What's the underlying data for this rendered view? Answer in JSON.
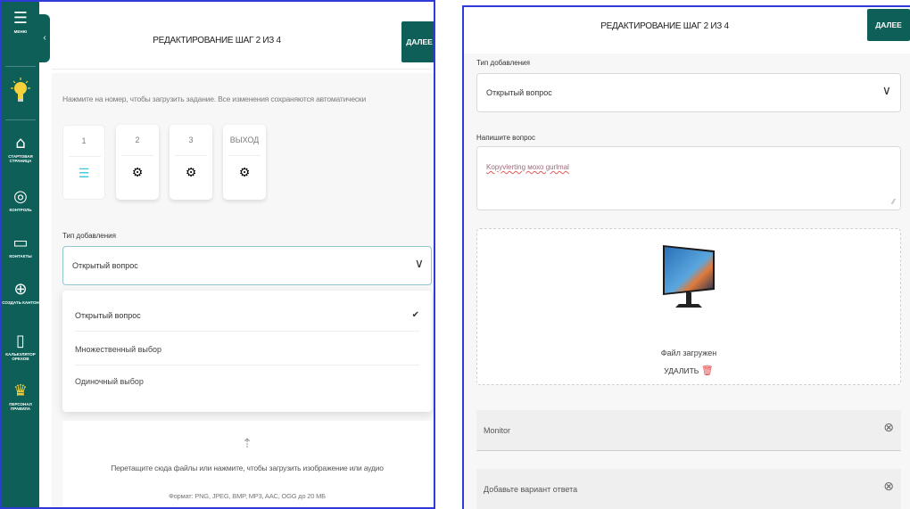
{
  "left": {
    "sidebar": {
      "menu_label": "МЕНЮ",
      "items": [
        {
          "icon": "home-icon",
          "label": "СТАРТОВАЯ СТРАНИЦА"
        },
        {
          "icon": "user-icon",
          "label": "КОНТРОЛЬ"
        },
        {
          "icon": "folder-icon",
          "label": "КОНТАКТЫ"
        },
        {
          "icon": "plus-circle-icon",
          "label": "СОЗДАТЬ КАНТОН"
        },
        {
          "icon": "phone-icon",
          "label": "КАЛЬКУЛЯТОР ОРЕХОВ"
        },
        {
          "icon": "crown-icon",
          "label": "ПЕРСОНАЛ ПРАВИЛА"
        }
      ]
    },
    "header": {
      "title": "РЕДАКТИРОВАНИЕ ШАГ 2 ИЗ 4",
      "next_label": "ДАЛЕЕ"
    },
    "hint": "Нажмите на номер, чтобы загрузить задание. Все изменения сохраняются автоматически",
    "steps": [
      {
        "label": "1",
        "icon": "list-icon"
      },
      {
        "label": "2",
        "icon": "gear-icon"
      },
      {
        "label": "3",
        "icon": "gear-icon"
      },
      {
        "label": "ВЫХОД",
        "icon": "gear-icon"
      }
    ],
    "type_label": "Тип добавления",
    "type_value": "Открытый вопрос",
    "options": [
      "Открытый вопрос",
      "Множественный выбор",
      "Одиночный выбор"
    ],
    "selected_option": "Открытый вопрос",
    "upload_text": "Перетащите сюда файлы или нажмите, чтобы загрузить изображение или аудио",
    "upload_format": "Формат: PNG, JPEG, BMP, MP3, AAC, OGG до 20 МБ"
  },
  "right": {
    "header": {
      "title": "РЕДАКТИРОВАНИЕ ШАГ 2 ИЗ 4",
      "next_label": "ДАЛЕЕ"
    },
    "type_label": "Тип добавления",
    "type_value": "Открытый вопрос",
    "question_label": "Напишите вопрос",
    "question_value": "Kopyvlerting мохо gurlmal",
    "upload_status": "Файл загружен",
    "delete_label": "УДАЛИТЬ",
    "answer_value": "Monitor",
    "answer_placeholder": "Добавьте вариант ответа"
  },
  "colors": {
    "accent": "#0e5f58",
    "divider": "#2f3bd6",
    "danger": "#e24b4b"
  }
}
